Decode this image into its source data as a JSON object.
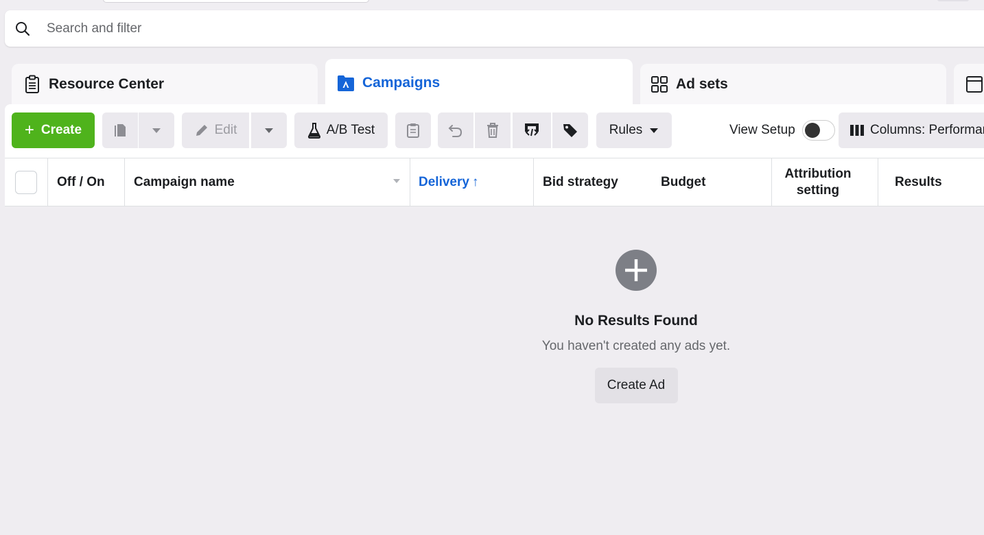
{
  "search": {
    "placeholder": "Search and filter"
  },
  "tabs": [
    {
      "label": "Resource Center",
      "icon": "clipboard-icon"
    },
    {
      "label": "Campaigns",
      "icon": "campaign-folder-icon",
      "active": true
    },
    {
      "label": "Ad sets",
      "icon": "grid-icon"
    },
    {
      "label": "",
      "icon": "ad-window-icon"
    }
  ],
  "toolbar": {
    "create_label": "Create",
    "edit_label": "Edit",
    "ab_test_label": "A/B Test",
    "rules_label": "Rules",
    "view_setup_label": "View Setup",
    "columns_label": "Columns: Performance"
  },
  "table": {
    "columns": [
      "Off / On",
      "Campaign name",
      "Delivery",
      "Bid strategy",
      "Budget",
      "Attribution setting",
      "Results"
    ],
    "delivery_sort": "↑"
  },
  "empty_state": {
    "title": "No Results Found",
    "subtitle": "You haven't created any ads yet.",
    "button_label": "Create Ad"
  },
  "colors": {
    "accent_blue": "#1565d8",
    "create_green": "#4fb31c",
    "background": "#efedf1"
  }
}
